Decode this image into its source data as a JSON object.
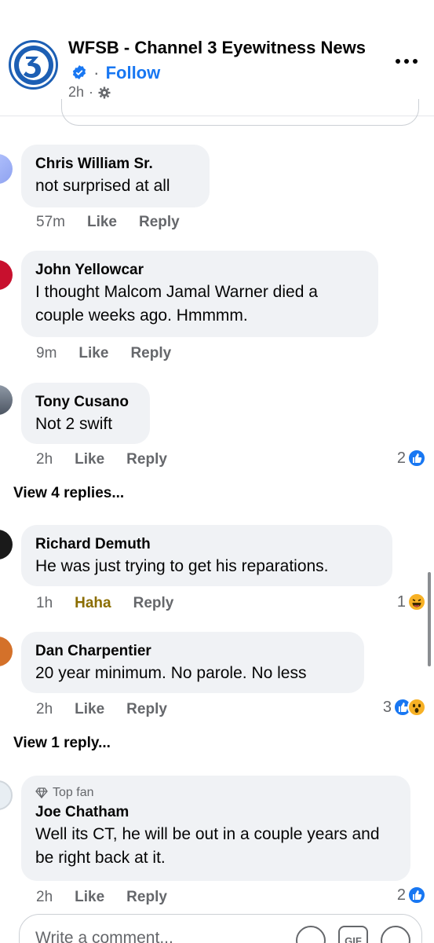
{
  "header": {
    "page_name": "WFSB - Channel 3 Eyewitness News",
    "follow_label": "Follow",
    "separator": "·",
    "time": "2h",
    "time_separator": "·",
    "verified_icon": "verified-badge-icon",
    "privacy_icon": "gear-icon"
  },
  "comments": [
    {
      "name": "Chris William Sr.",
      "text": "not surprised at all",
      "time": "57m",
      "like": "Like",
      "reply": "Reply"
    },
    {
      "name": "John Yellowcar",
      "text": "I thought Malcom Jamal Warner died a couple weeks ago. Hmmmm.",
      "time": "9m",
      "like": "Like",
      "reply": "Reply"
    },
    {
      "name": "Tony Cusano",
      "text": "Not 2 swift",
      "time": "2h",
      "like": "Like",
      "reply": "Reply",
      "reaction_count": "2",
      "reactions": [
        "like"
      ]
    },
    {
      "name": "Richard Demuth",
      "text": "He was just trying to get his reparations.",
      "time": "1h",
      "like": "Haha",
      "reply": "Reply",
      "reaction_count": "1",
      "reactions": [
        "haha"
      ]
    },
    {
      "name": "Dan Charpentier",
      "text": "20 year minimum. No parole. No less",
      "time": "2h",
      "like": "Like",
      "reply": "Reply",
      "reaction_count": "3",
      "reactions": [
        "like",
        "wow"
      ]
    },
    {
      "badge": "Top fan",
      "name": "Joe Chatham",
      "text": "Well its CT, he will be out in a couple years and be right back at it.",
      "time": "2h",
      "like": "Like",
      "reply": "Reply",
      "reaction_count": "2",
      "reactions": [
        "like"
      ]
    }
  ],
  "view_replies": [
    "View 4 replies...",
    "View 1 reply..."
  ],
  "composer": {
    "placeholder": "Write a comment...",
    "icons": [
      "avatar-sticker-icon",
      "gif-icon",
      "emoji-icon"
    ],
    "gif_label": "GIF"
  },
  "colors": {
    "accent": "#1877f2",
    "bubble": "#f0f2f5",
    "muted": "#65676b",
    "haha": "#8b6d00"
  }
}
